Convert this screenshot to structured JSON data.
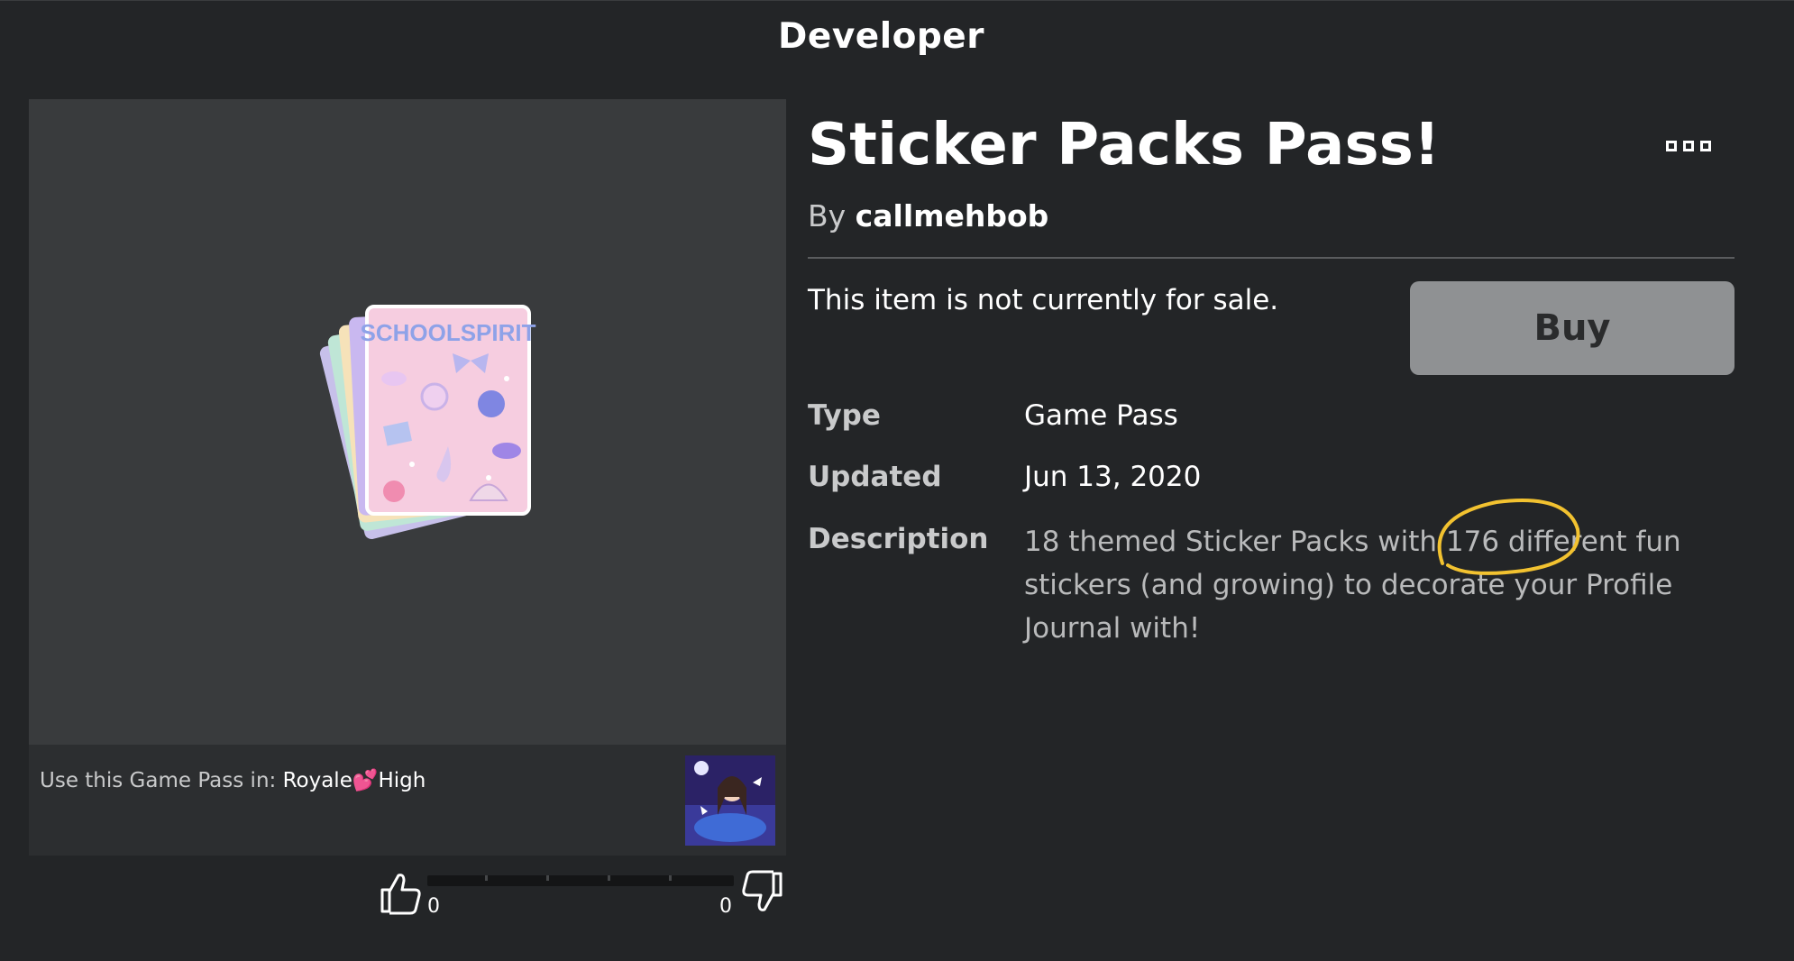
{
  "header": {
    "title": "Developer"
  },
  "thumbnail": {
    "art_lettering": "SCHOOLSPIRIT",
    "use_in_label": "Use this Game Pass in: ",
    "game_name": "Royale💕High"
  },
  "votes": {
    "up_count": "0",
    "down_count": "0",
    "up_fraction": 0
  },
  "item": {
    "title": "Sticker Packs Pass!",
    "by_prefix": "By ",
    "creator": "callmehbob",
    "sale_status": "This item is not currently for sale.",
    "buy_label": "Buy"
  },
  "details": {
    "type_label": "Type",
    "type_value": "Game Pass",
    "updated_label": "Updated",
    "updated_value": "Jun 13, 2020",
    "description_label": "Description",
    "description_value": "18 themed Sticker Packs with 176 different fun stickers (and growing) to decorate your Profile Journal with!"
  },
  "colors": {
    "background": "#232527",
    "panel": "#393b3d",
    "buy_disabled": "#8f9193",
    "annotation": "#f2c230"
  },
  "icons": [
    "more-options-icon",
    "thumbs-up-icon",
    "thumbs-down-icon"
  ]
}
